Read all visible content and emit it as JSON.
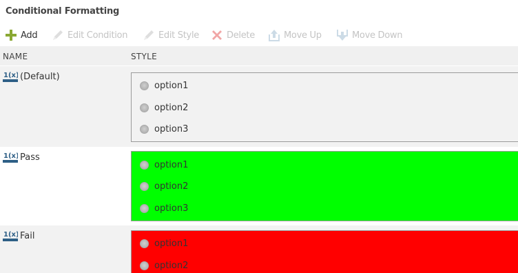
{
  "panel": {
    "title": "Conditional Formatting"
  },
  "toolbar": {
    "add_label": "Add",
    "edit_condition_label": "Edit Condition",
    "edit_style_label": "Edit Style",
    "delete_label": "Delete",
    "move_up_label": "Move Up",
    "move_down_label": "Move Down"
  },
  "columns": {
    "name": "NAME",
    "style": "STYLE"
  },
  "rows": [
    {
      "name": "(Default)",
      "style_background": "#f2f2f2",
      "options": [
        "option1",
        "option2",
        "option3"
      ]
    },
    {
      "name": "Pass",
      "style_background": "#00ff00",
      "options": [
        "option1",
        "option2",
        "option3"
      ]
    },
    {
      "name": "Fail",
      "style_background": "#ff0000",
      "options": [
        "option1",
        "option2"
      ]
    }
  ],
  "colors": {
    "add_icon": "#8aa833",
    "fx_icon": "#2e5f86",
    "delete_icon": "#e23b3b",
    "disabled_text": "#c4c4c4"
  }
}
